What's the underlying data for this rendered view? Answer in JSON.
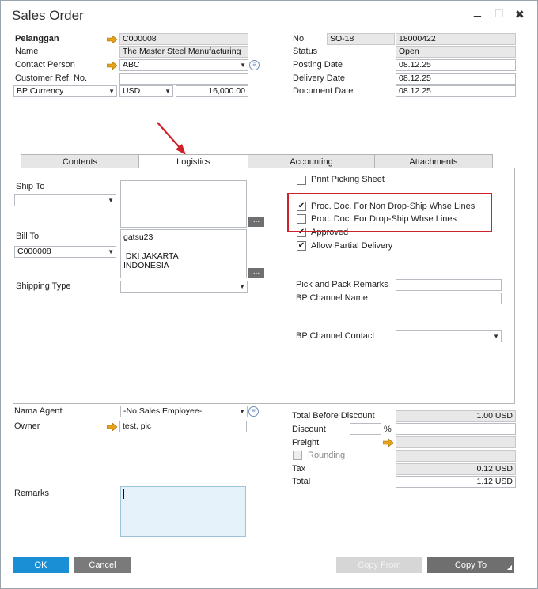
{
  "window": {
    "title": "Sales Order",
    "minimize": "_",
    "maximize": "□",
    "close": "✖"
  },
  "header_left": {
    "customer_label": "Pelanggan",
    "customer_value": "C000008",
    "name_label": "Name",
    "name_value": "The Master Steel Manufacturing",
    "contact_label": "Contact Person",
    "contact_value": "ABC",
    "custref_label": "Customer Ref. No.",
    "custref_value": "",
    "currency_type": "BP Currency",
    "currency": "USD",
    "currency_amount": "16,000.00"
  },
  "header_right": {
    "no_label": "No.",
    "series": "SO-18",
    "number": "18000422",
    "status_label": "Status",
    "status_value": "Open",
    "posting_label": "Posting Date",
    "posting_value": "08.12.25",
    "delivery_label": "Delivery Date",
    "delivery_value": "08.12.25",
    "document_label": "Document Date",
    "document_value": "08.12.25"
  },
  "tabs": [
    {
      "label": "Contents"
    },
    {
      "label": "Logistics"
    },
    {
      "label": "Accounting"
    },
    {
      "label": "Attachments"
    }
  ],
  "logistics": {
    "ship_to_label": "Ship To",
    "ship_to_select": "",
    "ship_to_address": "",
    "bill_to_label": "Bill To",
    "bill_to_select": "C000008",
    "bill_to_address": "gatsu23\n\n DKI JAKARTA\nINDONESIA",
    "shipping_type_label": "Shipping Type",
    "shipping_type_value": "",
    "more_button": "...",
    "print_picking": "Print Picking Sheet",
    "proc_non_drop": "Proc. Doc. For Non Drop-Ship Whse Lines",
    "proc_drop": "Proc. Doc. For Drop-Ship Whse Lines",
    "approved": "Approved",
    "allow_partial": "Allow Partial Delivery",
    "pick_pack_label": "Pick and Pack Remarks",
    "bp_channel_name_label": "BP Channel Name",
    "bp_channel_contact_label": "BP Channel Contact",
    "check_mark": "✔"
  },
  "footer_left": {
    "agent_label": "Nama Agent",
    "agent_value": "-No Sales Employee-",
    "owner_label": "Owner",
    "owner_value": "test, pic",
    "remarks_label": "Remarks"
  },
  "totals": {
    "before_discount_label": "Total Before Discount",
    "before_discount_value": "1.00 USD",
    "discount_label": "Discount",
    "discount_pct": "%",
    "freight_label": "Freight",
    "rounding_label": "Rounding",
    "tax_label": "Tax",
    "tax_value": "0.12 USD",
    "total_label": "Total",
    "total_value": "1.12 USD"
  },
  "buttons": {
    "ok": "OK",
    "cancel": "Cancel",
    "copy_from": "Copy From",
    "copy_to": "Copy To"
  },
  "colors": {
    "ok_button": "#1a8fd6",
    "cancel_button": "#7a7a7a",
    "copy_from_button": "#d6d6d6",
    "copy_to_button": "#6f6f6f",
    "highlight_red": "#d0212a",
    "link_arrow": "#e8a21a"
  }
}
